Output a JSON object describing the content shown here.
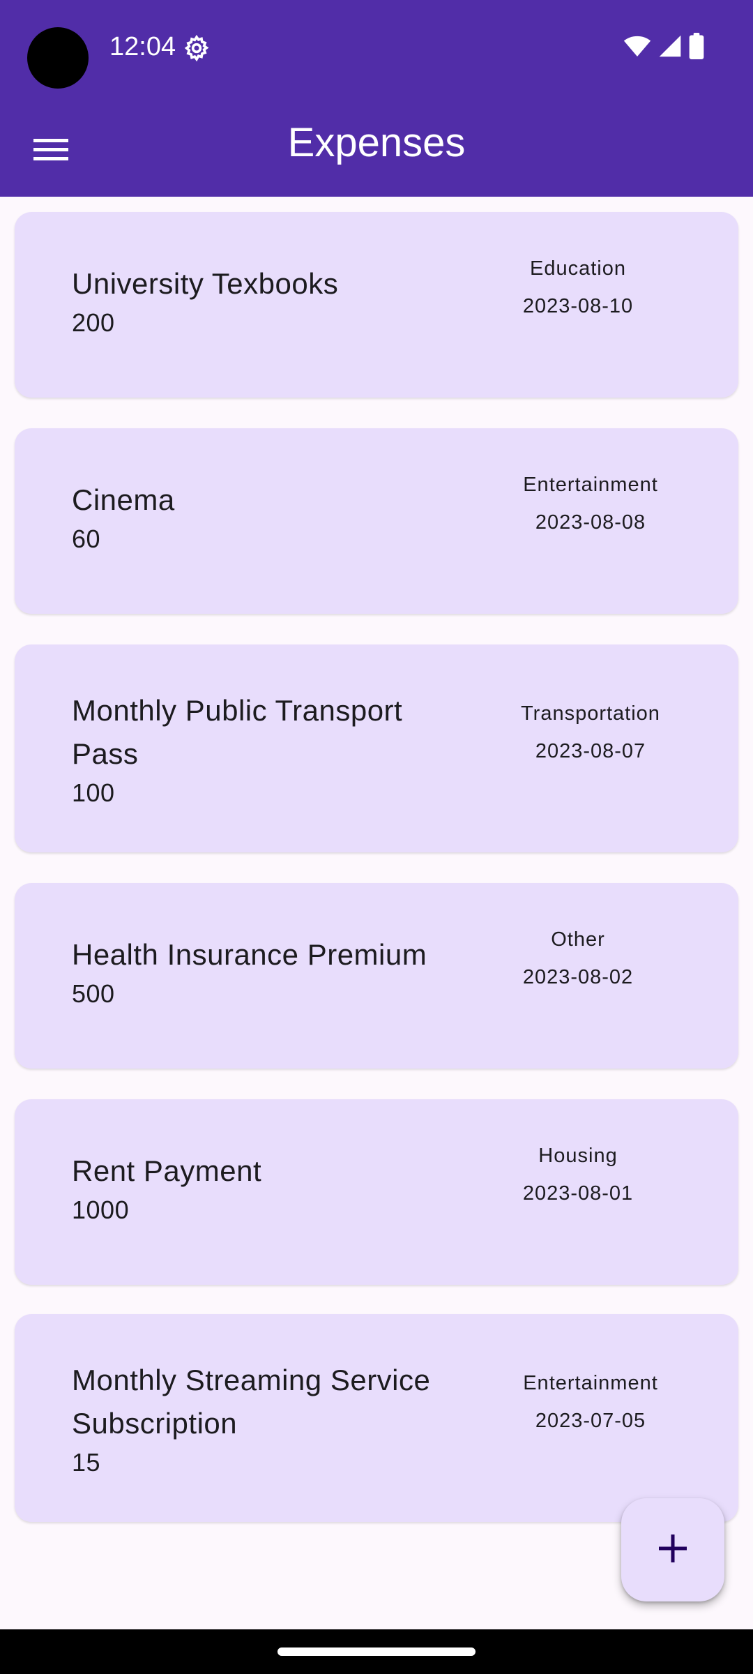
{
  "status_bar": {
    "time": "12:04",
    "icons": [
      "settings-gear-icon",
      "wifi-icon",
      "signal-icon",
      "battery-icon"
    ]
  },
  "app_bar": {
    "title": "Expenses",
    "menu_icon": "hamburger-menu-icon",
    "background_color": "#512da8"
  },
  "expenses": [
    {
      "title": "University Texbooks",
      "amount": "200",
      "category": "Education",
      "date": "2023-08-10"
    },
    {
      "title": "Cinema",
      "amount": "60",
      "category": "Entertainment",
      "date": "2023-08-08"
    },
    {
      "title": "Monthly Public Transport Pass",
      "amount": "100",
      "category": "Transportation",
      "date": "2023-08-07"
    },
    {
      "title": "Health Insurance Premium",
      "amount": "500",
      "category": "Other",
      "date": "2023-08-02"
    },
    {
      "title": "Rent Payment",
      "amount": "1000",
      "category": "Housing",
      "date": "2023-08-01"
    },
    {
      "title": "Monthly Streaming Service Subscription",
      "amount": "15",
      "category": "Entertainment",
      "date": "2023-07-05"
    }
  ],
  "fab": {
    "icon": "plus-icon"
  },
  "colors": {
    "card_background": "#e8ddfc",
    "page_background": "#fdf8fd",
    "accent": "#512da8"
  }
}
